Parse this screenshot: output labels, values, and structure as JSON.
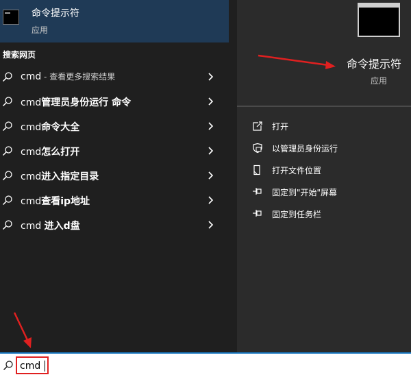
{
  "best_match": {
    "title": "命令提示符",
    "subtitle": "应用",
    "icon": "cmd-app-icon"
  },
  "web_section": {
    "label": "搜索网页"
  },
  "suggestions": [
    {
      "prefix": "cmd",
      "bold": "",
      "sub": " - 查看更多搜索结果",
      "icon": "search-icon"
    },
    {
      "prefix": "cmd",
      "bold": "管理员身份运行 命令",
      "sub": "",
      "icon": "search-icon"
    },
    {
      "prefix": "cmd",
      "bold": "命令大全",
      "sub": "",
      "icon": "search-icon"
    },
    {
      "prefix": "cmd",
      "bold": "怎么打开",
      "sub": "",
      "icon": "search-icon"
    },
    {
      "prefix": "cmd",
      "bold": "进入指定目录",
      "sub": "",
      "icon": "search-icon"
    },
    {
      "prefix": "cmd",
      "bold": "查看ip地址",
      "sub": "",
      "icon": "search-icon"
    },
    {
      "prefix": "cmd ",
      "bold": "进入d盘",
      "sub": "",
      "icon": "search-icon"
    }
  ],
  "detail": {
    "title": "命令提示符",
    "subtitle": "应用",
    "actions": [
      {
        "label": "打开",
        "icon": "open-icon"
      },
      {
        "label": "以管理员身份运行",
        "icon": "shield-icon"
      },
      {
        "label": "打开文件位置",
        "icon": "file-location-icon"
      },
      {
        "label": "固定到\"开始\"屏幕",
        "icon": "pin-icon"
      },
      {
        "label": "固定到任务栏",
        "icon": "pin-icon"
      }
    ]
  },
  "search": {
    "value": "cmd"
  },
  "colors": {
    "best_match_bg": "#1f3a56",
    "left_bg": "#1f1f1f",
    "right_bg": "#2b2b2b",
    "search_border": "#1a79c2",
    "annotation": "#e02020"
  }
}
